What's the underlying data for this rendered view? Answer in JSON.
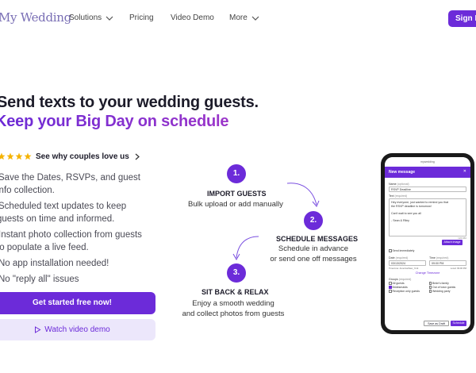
{
  "header": {
    "logo": "My Wedding",
    "nav": [
      {
        "label": "Solutions",
        "dropdown": true
      },
      {
        "label": "Pricing",
        "dropdown": false
      },
      {
        "label": "Video Demo",
        "dropdown": false
      },
      {
        "label": "More",
        "dropdown": true
      }
    ],
    "signin_label": "Sign In"
  },
  "hero": {
    "headline_line1": "Send texts to your wedding guests.",
    "headline_line2": "Keep your Big Day on schedule",
    "rating_stars": 5,
    "couples_link": "See why couples love us",
    "bullets": [
      {
        "line1": "Save the Dates, RSVPs, and guest",
        "line2": "info collection."
      },
      {
        "line1": "Scheduled text updates to keep",
        "line2": "guests on time and informed."
      },
      {
        "line1": "Instant photo collection from guests",
        "line2": "to populate a live feed."
      },
      {
        "line1": "No app installation needed!",
        "line2": ""
      },
      {
        "line1": "No \"reply all\" issues",
        "line2": ""
      }
    ],
    "cta_label": "Get started free now!",
    "demo_label": "Watch video demo"
  },
  "steps": [
    {
      "number": "1.",
      "title": "IMPORT GUESTS",
      "desc_line1": "Bulk upload or add manually",
      "desc_line2": ""
    },
    {
      "number": "2.",
      "title": "SCHEDULE MESSAGES",
      "desc_line1": "Schedule in advance",
      "desc_line2": "or send one off messages"
    },
    {
      "number": "3.",
      "title": "SIT BACK & RELAX",
      "desc_line1": "Enjoy a smooth wedding",
      "desc_line2": "and collect photos from guests"
    }
  ],
  "phone": {
    "url": "mywedding",
    "title": "New message",
    "name_label": "Name",
    "name_hint": "(optional)",
    "name_value": "RSVP Deadline",
    "text_label": "Text",
    "text_hint": "(required)",
    "text_lines": [
      "Hey everyone, just wanted to remind you that",
      "the RSVP deadline is tomorrow!",
      "",
      "Can't wait to see you all",
      "",
      "- Sean & Riley"
    ],
    "char_count": "120/450",
    "attach_label": "Attach image",
    "send_now_label": "Send immediately",
    "date_label": "Date",
    "date_hint": "(required)",
    "date_value": "03/13/2024",
    "time_label": "Time",
    "time_hint": "(required)",
    "time_value": "09:00 PM",
    "tz_left": "Timezone: America/New_York",
    "tz_right": "Local: 09:00 PM",
    "change_tz": "Change Timezone",
    "groups_label": "Groups",
    "groups_hint": "(required)",
    "groups": [
      {
        "label": "All guests",
        "checked": false
      },
      {
        "label": "Bride's family",
        "checked": false
      },
      {
        "label": "Bridesmaids",
        "checked": true
      },
      {
        "label": "Out of town guests",
        "checked": false
      },
      {
        "label": "Reception only guests",
        "checked": false
      },
      {
        "label": "Wedding party",
        "checked": false
      }
    ],
    "draft_label": "Save as Draft",
    "schedule_label": "Schedule"
  },
  "colors": {
    "brand": "#6c2bd9",
    "brand_light": "#ece7fb",
    "gradient_end": "#9b35c9",
    "star": "#f5b301"
  }
}
